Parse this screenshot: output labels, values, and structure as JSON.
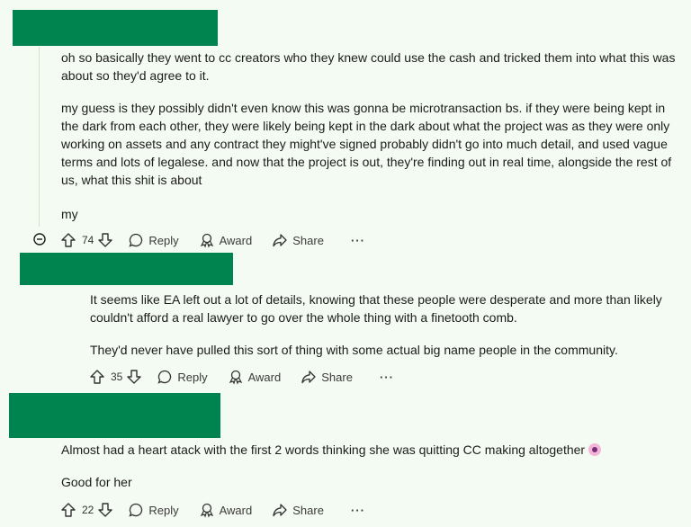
{
  "comments": [
    {
      "paragraphs": [
        "oh so basically they went to cc creators who they knew could use the cash and tricked them into what this was about so they'd agree to it.",
        "my guess is they possibly didn't even know this was gonna be microtransaction bs. if they were being kept in the dark from each other, they were likely being kept in the dark about what the project was as they were only working on assets and any contract they might've signed probably didn't go into much detail, and used vague terms and lots of legalese. and now that the project is out, they're finding out in real time, alongside the rest of us, what this shit is about",
        "my"
      ],
      "votes": "74"
    },
    {
      "paragraphs": [
        "It seems like EA left out a lot of details, knowing that these people were desperate and more than likely couldn't afford a real lawyer to go over the whole thing with a finetooth comb.",
        "They'd never have pulled this sort of thing with some actual big name people in the community."
      ],
      "votes": "35"
    },
    {
      "paragraphs": [
        "Almost had a heart atack with the first 2 words thinking she was quitting CC making altogether",
        "Good for her"
      ],
      "votes": "22",
      "emoji": "face-screaming-emoji"
    }
  ],
  "actions": {
    "reply": "Reply",
    "award": "Award",
    "share": "Share",
    "more": "···"
  },
  "colors": {
    "background": "#f4fbf2",
    "redaction": "#00844f",
    "thread_line": "#cfe6c9"
  }
}
